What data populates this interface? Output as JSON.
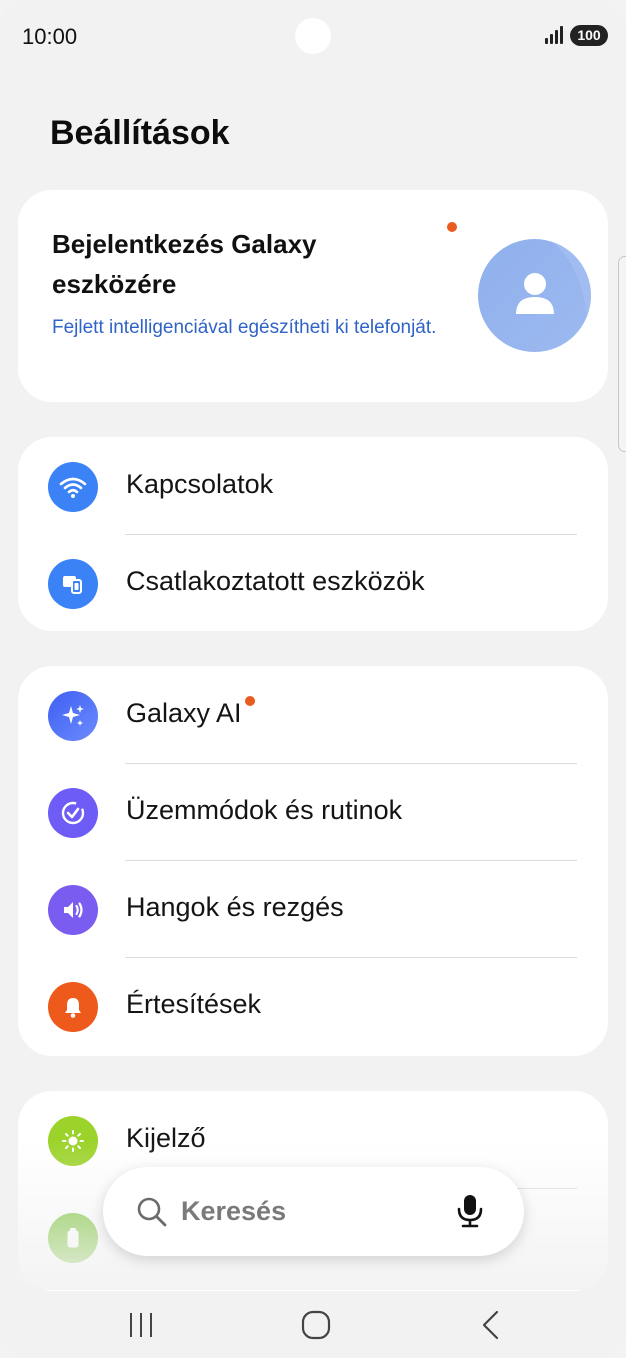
{
  "status_bar": {
    "time": "10:00",
    "battery": "100"
  },
  "page_title": "Beállítások",
  "account": {
    "title": "Bejelentkezés Galaxy eszközére",
    "subtitle": "Fejlett intelligenciával egészítheti ki telefonját."
  },
  "groups": {
    "connections": [
      {
        "label": "Kapcsolatok",
        "icon": "wifi-icon",
        "color": "#3b82f6"
      },
      {
        "label": "Csatlakoztatott eszközök",
        "icon": "connected-devices-icon",
        "color": "#3b82f6"
      }
    ],
    "features": [
      {
        "label": "Galaxy AI",
        "icon": "sparkle-icon",
        "color": "#4f6cf0"
      },
      {
        "label": "Üzemmódok és rutinok",
        "icon": "modes-check-icon",
        "color": "#6d5cf5"
      },
      {
        "label": "Hangok és rezgés",
        "icon": "speaker-icon",
        "color": "#7a5cf0"
      },
      {
        "label": "Értesítések",
        "icon": "bell-icon",
        "color": "#ee5a1c"
      }
    ],
    "display": [
      {
        "label": "Kijelző",
        "icon": "sun-icon",
        "color": "#9bd32a"
      },
      {
        "label": "",
        "icon": "battery-icon",
        "color": "#7cc43a"
      }
    ]
  },
  "search": {
    "placeholder": "Keresés"
  },
  "colors": {
    "accent_blue": "#2f63c7",
    "badge_orange": "#ea5b1f"
  }
}
